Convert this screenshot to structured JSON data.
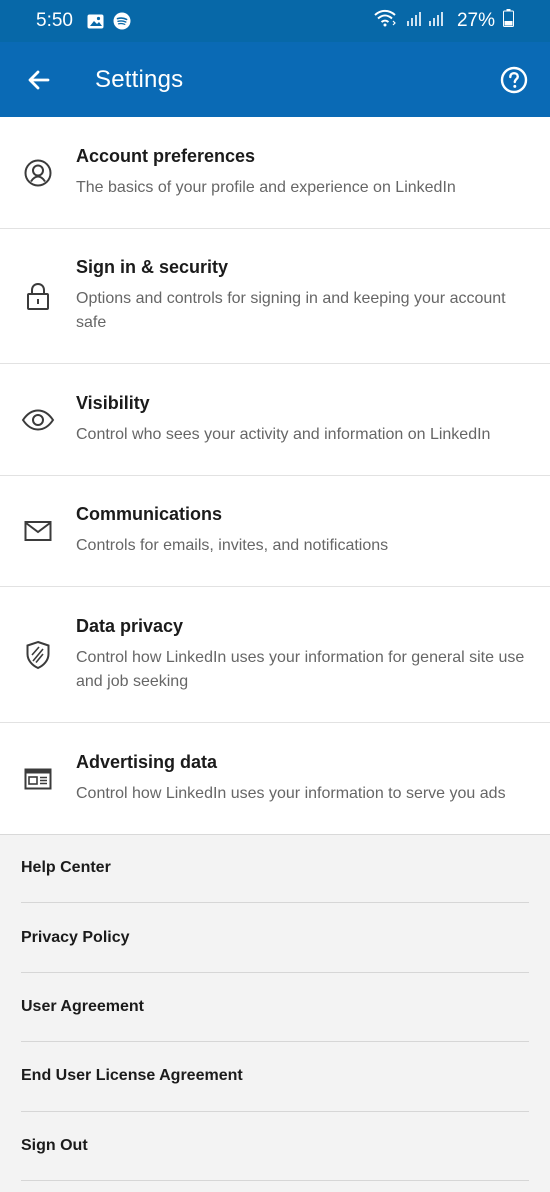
{
  "status_bar": {
    "time": "5:50",
    "battery": "27%",
    "icons": [
      "image-icon",
      "spotify-icon",
      "wifi-icon",
      "signal-icon",
      "battery-icon"
    ]
  },
  "app_bar": {
    "title": "Settings",
    "back_icon": "arrow-left-icon",
    "help_icon": "help-circle-icon"
  },
  "settings": [
    {
      "title": "Account preferences",
      "desc": "The basics of your profile and experience on LinkedIn",
      "icon": "user-circle-icon"
    },
    {
      "title": "Sign in & security",
      "desc": "Options and controls for signing in and keeping your account safe",
      "icon": "lock-icon"
    },
    {
      "title": "Visibility",
      "desc": "Control who sees your activity and information on LinkedIn",
      "icon": "eye-icon"
    },
    {
      "title": "Communications",
      "desc": "Controls for emails, invites, and notifications",
      "icon": "envelope-icon"
    },
    {
      "title": "Data privacy",
      "desc": "Control how LinkedIn uses your information for general site use and job seeking",
      "icon": "shield-icon"
    },
    {
      "title": "Advertising data",
      "desc": "Control how LinkedIn uses your information to serve you ads",
      "icon": "ad-icon"
    }
  ],
  "footer_links": [
    "Help Center",
    "Privacy Policy",
    "User Agreement",
    "End User License Agreement",
    "Sign Out"
  ],
  "colors": {
    "header": "#0a6ab5",
    "status_bar": "#0768a8"
  }
}
